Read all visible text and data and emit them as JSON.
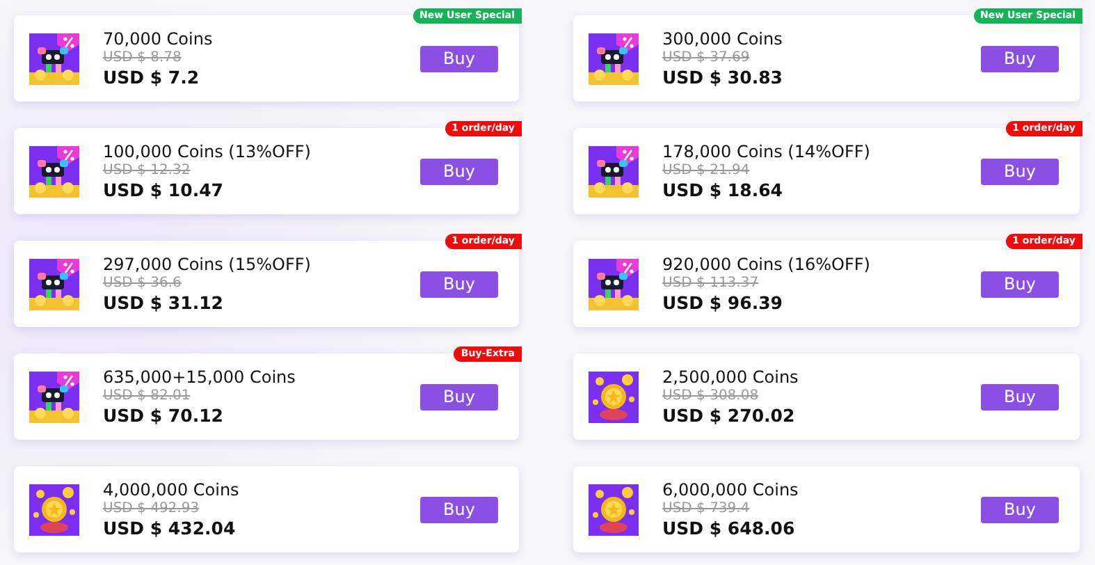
{
  "offers": [
    {
      "title": "70,000 Coins",
      "original_price": "USD $ 8.78",
      "price": "USD $ 7.2",
      "kind": "promo",
      "badge": {
        "label": "New User Special",
        "color": "#16b25a"
      },
      "button": "Buy"
    },
    {
      "title": "300,000 Coins",
      "original_price": "USD $ 37.69",
      "price": "USD $ 30.83",
      "kind": "promo",
      "badge": {
        "label": "New User Special",
        "color": "#16b25a"
      },
      "button": "Buy"
    },
    {
      "title": "100,000 Coins (13%OFF)",
      "original_price": "USD $ 12.32",
      "price": "USD $ 10.47",
      "kind": "promo",
      "badge": {
        "label": "1 order/day",
        "color": "#f20a0a"
      },
      "button": "Buy"
    },
    {
      "title": "178,000 Coins (14%OFF)",
      "original_price": "USD $ 21.94",
      "price": "USD $ 18.64",
      "kind": "promo",
      "badge": {
        "label": "1 order/day",
        "color": "#f20a0a"
      },
      "button": "Buy"
    },
    {
      "title": "297,000 Coins (15%OFF)",
      "original_price": "USD $ 36.6",
      "price": "USD $ 31.12",
      "kind": "promo",
      "badge": {
        "label": "1 order/day",
        "color": "#f20a0a"
      },
      "button": "Buy"
    },
    {
      "title": "920,000 Coins (16%OFF)",
      "original_price": "USD $ 113.37",
      "price": "USD $ 96.39",
      "kind": "promo",
      "badge": {
        "label": "1 order/day",
        "color": "#f20a0a"
      },
      "button": "Buy"
    },
    {
      "title": "635,000+15,000 Coins",
      "original_price": "USD $ 82.01",
      "price": "USD $ 70.12",
      "kind": "promo",
      "badge": {
        "label": "Buy-Extra",
        "color": "#f20a0a"
      },
      "button": "Buy"
    },
    {
      "title": "2,500,000 Coins",
      "original_price": "USD $ 308.08",
      "price": "USD $ 270.02",
      "kind": "coins",
      "button": "Buy"
    },
    {
      "title": "4,000,000 Coins",
      "original_price": "USD $ 492.93",
      "price": "USD $ 432.04",
      "kind": "coins",
      "button": "Buy"
    },
    {
      "title": "6,000,000 Coins",
      "original_price": "USD $ 739.4",
      "price": "USD $ 648.06",
      "kind": "coins",
      "button": "Buy"
    }
  ]
}
